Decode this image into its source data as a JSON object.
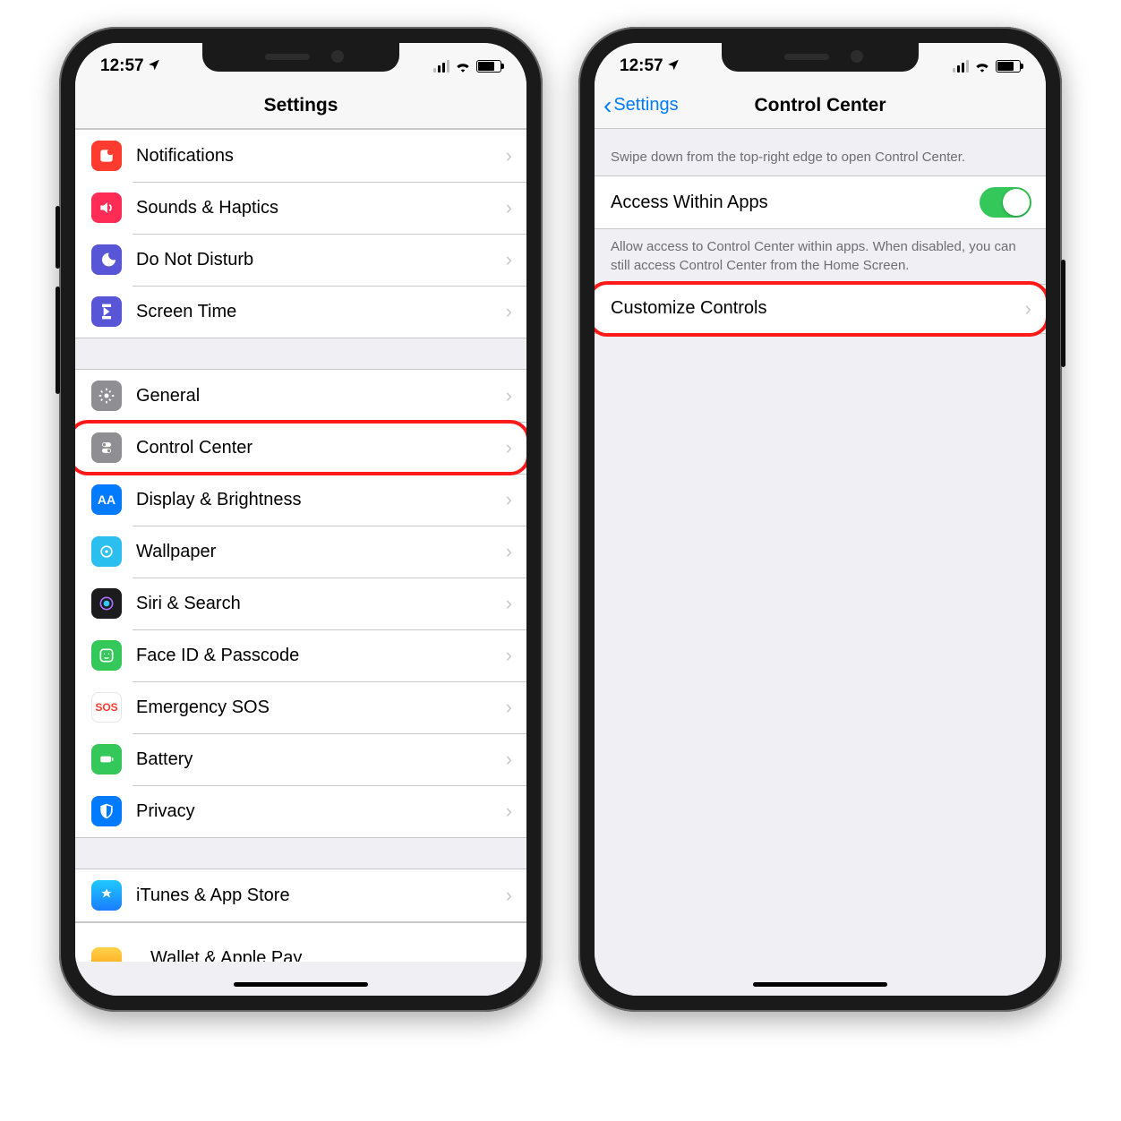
{
  "status": {
    "time": "12:57",
    "location_arrow": "➤",
    "signal_label": "cellular-signal",
    "wifi_label": "wifi",
    "battery_label": "battery"
  },
  "left_screen": {
    "title": "Settings",
    "groups": [
      {
        "items": [
          {
            "label": "Notifications",
            "icon_name": "notifications-icon",
            "highlight": false
          },
          {
            "label": "Sounds & Haptics",
            "icon_name": "sounds-icon",
            "highlight": false
          },
          {
            "label": "Do Not Disturb",
            "icon_name": "dnd-icon",
            "highlight": false
          },
          {
            "label": "Screen Time",
            "icon_name": "screentime-icon",
            "highlight": false
          }
        ]
      },
      {
        "items": [
          {
            "label": "General",
            "icon_name": "general-icon",
            "highlight": false
          },
          {
            "label": "Control Center",
            "icon_name": "control-center-icon",
            "highlight": true
          },
          {
            "label": "Display & Brightness",
            "icon_name": "display-icon",
            "highlight": false
          },
          {
            "label": "Wallpaper",
            "icon_name": "wallpaper-icon",
            "highlight": false
          },
          {
            "label": "Siri & Search",
            "icon_name": "siri-icon",
            "highlight": false
          },
          {
            "label": "Face ID & Passcode",
            "icon_name": "faceid-icon",
            "highlight": false
          },
          {
            "label": "Emergency SOS",
            "icon_name": "sos-icon",
            "highlight": false
          },
          {
            "label": "Battery",
            "icon_name": "battery-icon",
            "highlight": false
          },
          {
            "label": "Privacy",
            "icon_name": "privacy-icon",
            "highlight": false
          }
        ]
      },
      {
        "items": [
          {
            "label": "iTunes & App Store",
            "icon_name": "appstore-icon",
            "highlight": false
          }
        ]
      }
    ],
    "partial_row_label": "Wallet & Apple Pay"
  },
  "right_screen": {
    "back_label": "Settings",
    "title": "Control Center",
    "hint_top": "Swipe down from the top-right edge to open Control Center.",
    "toggle_row": {
      "label": "Access Within Apps",
      "on": true
    },
    "hint_bottom": "Allow access to Control Center within apps. When disabled, you can still access Control Center from the Home Screen.",
    "customize_row": {
      "label": "Customize Controls",
      "highlight": true
    }
  },
  "colors": {
    "accent": "#007aff",
    "highlight": "#ff1a1a",
    "toggle_on": "#34c759"
  }
}
